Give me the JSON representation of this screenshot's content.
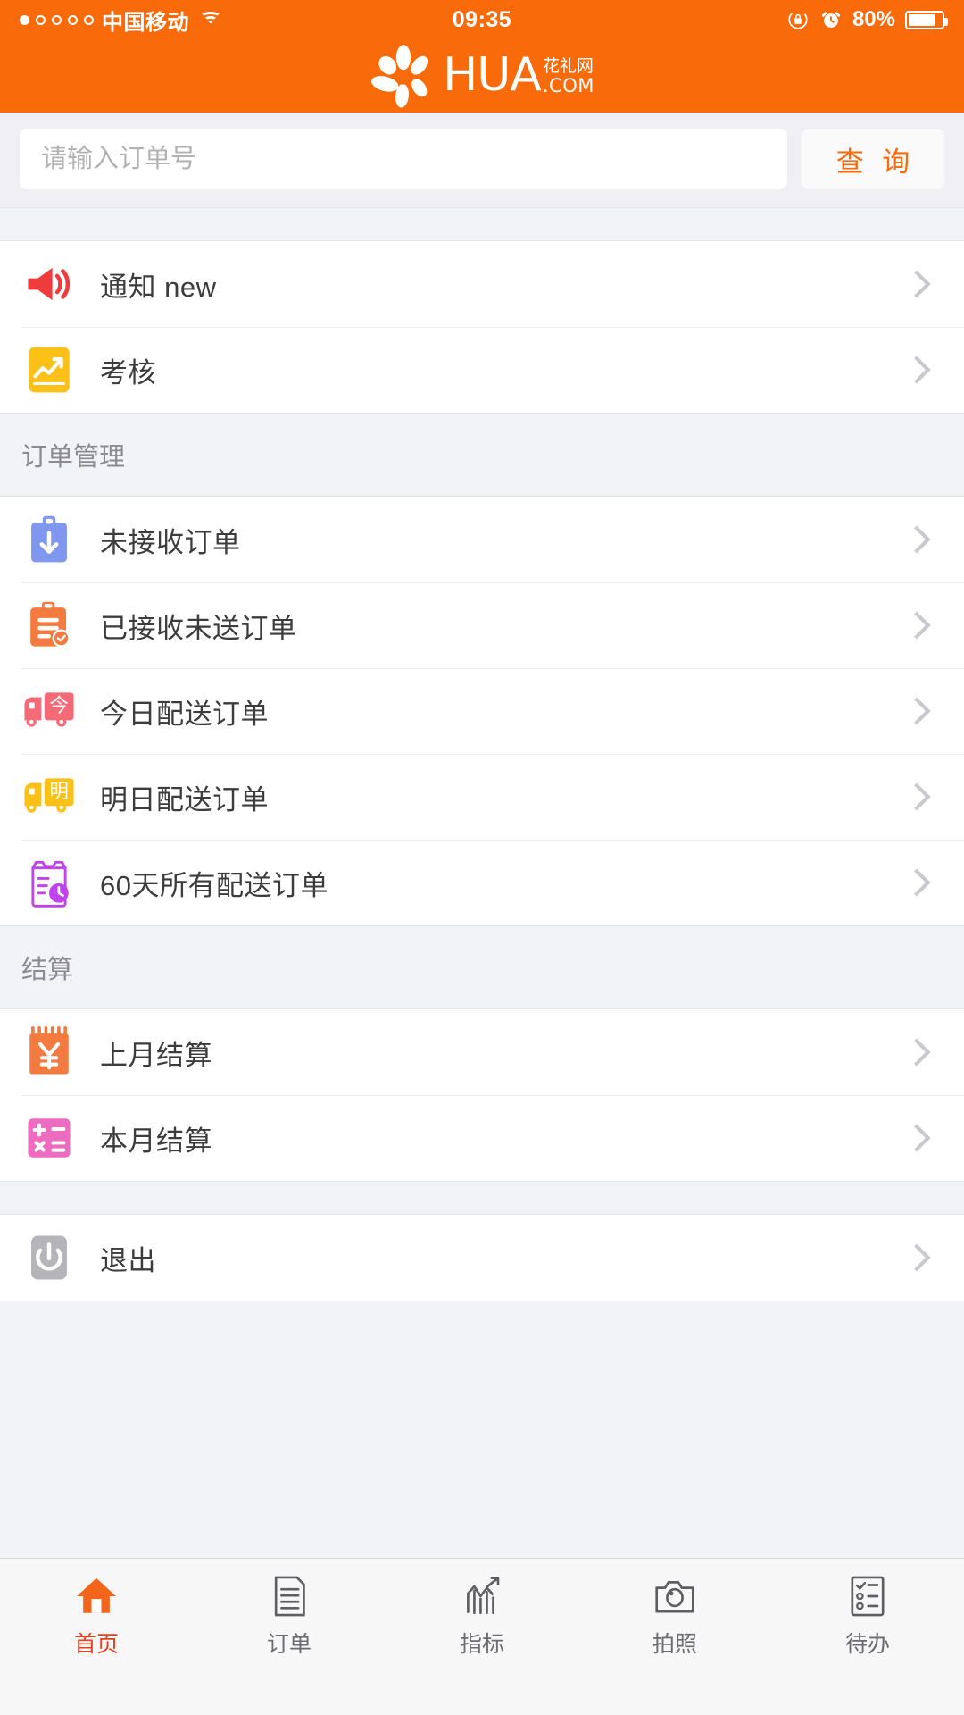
{
  "statusbar": {
    "signal_dots_filled": 1,
    "signal_dots_total": 5,
    "carrier": "中国移动",
    "wifi_icon": "wifi-icon",
    "time": "09:35",
    "rotation_lock_icon": "rotation-lock-icon",
    "alarm_icon": "alarm-clock-icon",
    "battery_percent": "80%",
    "battery_level": 80,
    "battery_icon": "battery-icon"
  },
  "header": {
    "logo_icon": "flower-logo-icon",
    "brand": "HUA",
    "brand_cn": "花礼网",
    "brand_tld": ".COM"
  },
  "search": {
    "placeholder": "请输入订单号",
    "value": "",
    "button_label": "查 询"
  },
  "groups": [
    {
      "header": null,
      "rows": [
        {
          "icon": "megaphone-icon",
          "label": "通知 new",
          "chevron": "chevron-right-icon"
        },
        {
          "icon": "trending-chart-icon",
          "label": "考核",
          "chevron": "chevron-right-icon"
        }
      ]
    },
    {
      "header": "订单管理",
      "rows": [
        {
          "icon": "clipboard-download-icon",
          "label": "未接收订单",
          "chevron": "chevron-right-icon"
        },
        {
          "icon": "clipboard-check-icon",
          "label": "已接收未送订单",
          "chevron": "chevron-right-icon"
        },
        {
          "icon": "truck-today-icon",
          "label": "今日配送订单",
          "chevron": "chevron-right-icon"
        },
        {
          "icon": "truck-tomorrow-icon",
          "label": "明日配送订单",
          "chevron": "chevron-right-icon"
        },
        {
          "icon": "clipboard-clock-icon",
          "label": "60天所有配送订单",
          "chevron": "chevron-right-icon"
        }
      ]
    },
    {
      "header": "结算",
      "rows": [
        {
          "icon": "yuan-calendar-icon",
          "label": "上月结算",
          "chevron": "chevron-right-icon"
        },
        {
          "icon": "calculator-icon",
          "label": "本月结算",
          "chevron": "chevron-right-icon"
        }
      ]
    },
    {
      "header": null,
      "rows": [
        {
          "icon": "power-icon",
          "label": "退出",
          "chevron": "chevron-right-icon"
        }
      ]
    }
  ],
  "tabbar": [
    {
      "icon": "home-icon",
      "label": "首页",
      "active": true
    },
    {
      "icon": "document-icon",
      "label": "订单",
      "active": false
    },
    {
      "icon": "bar-chart-icon",
      "label": "指标",
      "active": false
    },
    {
      "icon": "camera-icon",
      "label": "拍照",
      "active": false
    },
    {
      "icon": "checklist-icon",
      "label": "待办",
      "active": false
    }
  ],
  "colors": {
    "brand_orange": "#f96a0a",
    "accent_orange": "#e8411f",
    "page_bg": "#f2f3f7",
    "row_bg": "#ffffff",
    "icon_red": "#ef3b3b",
    "icon_yellow": "#fbc117",
    "icon_blue": "#7f97ee",
    "icon_orange": "#f47b40",
    "icon_pink": "#f56a77",
    "icon_purple": "#c043ee",
    "icon_magenta": "#ee6cc0",
    "icon_gray": "#b4b4b9"
  }
}
